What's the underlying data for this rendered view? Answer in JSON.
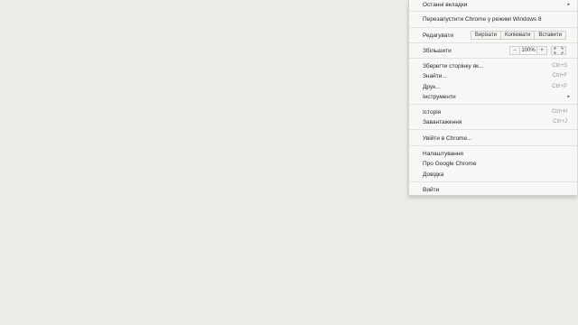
{
  "menu": {
    "recent_tabs": "Останні вкладки",
    "relaunch": "Перезапустити Chrome у режимі Windows 8",
    "edit_label": "Редагувати",
    "cut": "Вирізати",
    "copy": "Копіювати",
    "paste": "Вставити",
    "zoom_label": "Збільшити",
    "zoom_minus": "−",
    "zoom_value": "100%",
    "zoom_plus": "+",
    "save_page": "Зберегти сторінку як...",
    "save_page_shortcut": "Ctrl+S",
    "find": "Знайти...",
    "find_shortcut": "Ctrl+F",
    "print": "Друк...",
    "print_shortcut": "Ctrl+P",
    "tools": "Інструменти",
    "history": "Історія",
    "history_shortcut": "Ctrl+H",
    "downloads": "Завантаження",
    "downloads_shortcut": "Ctrl+J",
    "sign_in": "Увійти в Chrome...",
    "settings": "Налаштування",
    "about": "Про Google Chrome",
    "help": "Довідка",
    "exit": "Вийти"
  },
  "icons": {
    "submenu_arrow": "chevron-right-icon",
    "fullscreen": "fullscreen-icon"
  },
  "colors": {
    "background": "#ebebe7",
    "menu_background": "#f7f7f5",
    "shortcut_text": "#9a9a9a"
  }
}
